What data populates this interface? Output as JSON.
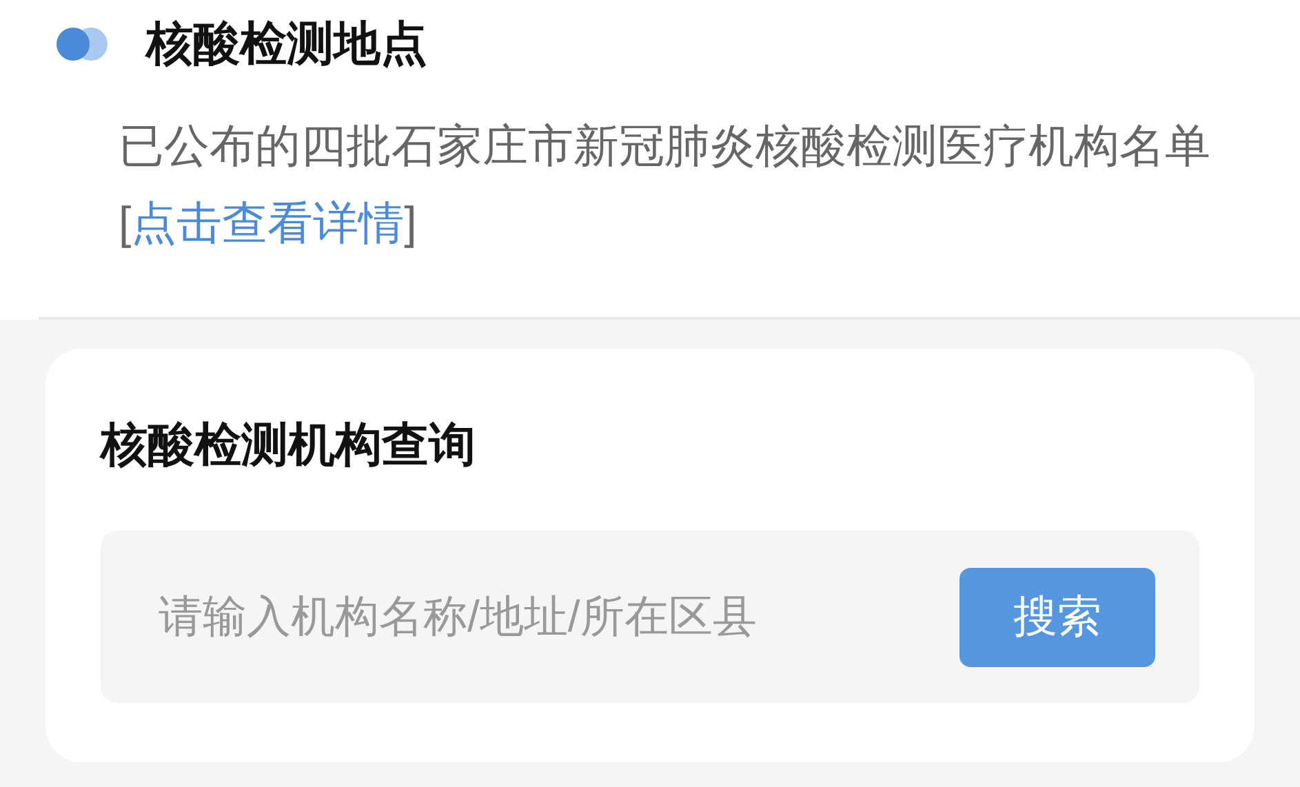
{
  "section": {
    "title": "核酸检测地点"
  },
  "notice": {
    "text_before": "已公布的四批石家庄市新冠肺炎核酸检测医疗机构名单[",
    "link": "点击查看详情",
    "text_after": "]"
  },
  "query_card": {
    "title": "核酸检测机构查询",
    "search": {
      "placeholder": "请输入机构名称/地址/所在区县"
    },
    "button": "搜索"
  }
}
